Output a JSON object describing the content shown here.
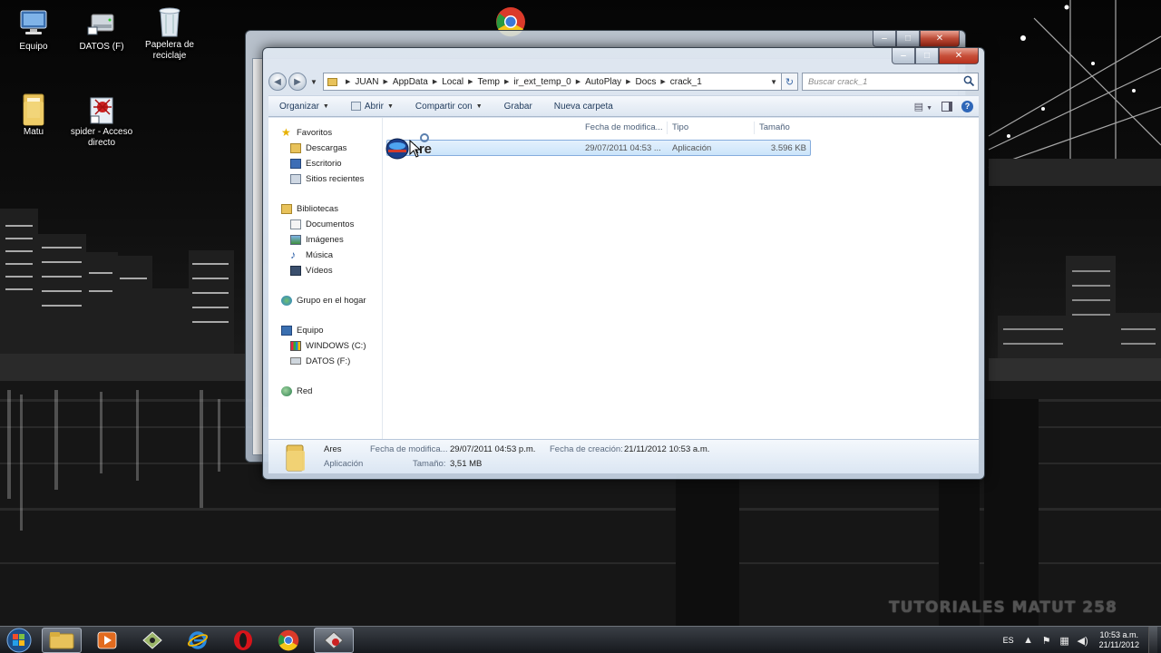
{
  "desktop": {
    "icons": [
      {
        "label": "Equipo"
      },
      {
        "label": "DATOS (F)"
      },
      {
        "label": "Papelera de reciclaje"
      },
      {
        "label": "Matu"
      },
      {
        "label": "spider - Acceso directo"
      }
    ]
  },
  "explorer": {
    "caption_buttons": {
      "minimize": "‒",
      "maximize": "□",
      "close": "✕"
    },
    "breadcrumb": [
      "JUAN",
      "AppData",
      "Local",
      "Temp",
      "ir_ext_temp_0",
      "AutoPlay",
      "Docs",
      "crack_1"
    ],
    "search_placeholder": "Buscar crack_1",
    "toolbar": {
      "organize": "Organizar",
      "open": "Abrir",
      "share": "Compartir con",
      "burn": "Grabar",
      "new_folder": "Nueva carpeta"
    },
    "nav": {
      "favorites": "Favoritos",
      "downloads": "Descargas",
      "desktop": "Escritorio",
      "recent": "Sitios recientes",
      "libraries": "Bibliotecas",
      "documents": "Documentos",
      "images": "Imágenes",
      "music": "Música",
      "videos": "Vídeos",
      "homegroup": "Grupo en el hogar",
      "computer": "Equipo",
      "drive_c": "WINDOWS (C:)",
      "drive_f": "DATOS (F:)",
      "network": "Red"
    },
    "columns": {
      "modified": "Fecha de modifica...",
      "type": "Tipo",
      "size": "Tamaño"
    },
    "file": {
      "drag_label": "Are",
      "modified": "29/07/2011 04:53 ...",
      "type": "Aplicación",
      "size": "3.596 KB"
    },
    "details": {
      "name": "Ares",
      "kind": "Aplicación",
      "modified_label": "Fecha de modifica...",
      "modified_value": "29/07/2011 04:53 p.m.",
      "created_label": "Fecha de creación:",
      "created_value": "21/11/2012 10:53 a.m.",
      "size_label": "Tamaño:",
      "size_value": "3,51 MB"
    }
  },
  "watermark": "TUTORIALES MATUT 258",
  "taskbar": {
    "language": "ES",
    "time": "10:53 a.m.",
    "date": "21/11/2012"
  }
}
